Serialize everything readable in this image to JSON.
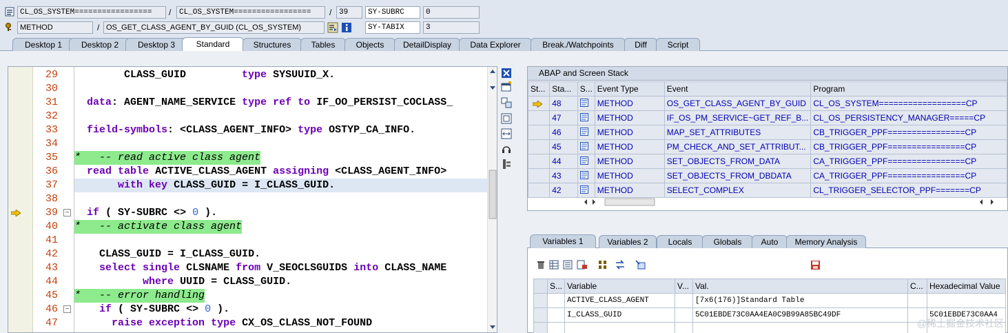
{
  "top_fields": {
    "row1": {
      "class1": "CL_OS_SYSTEM=================",
      "sep1": "/",
      "class2": "CL_OS_SYSTEM=================",
      "sep2": "/",
      "line": "39",
      "sysvar": "SY-SUBRC",
      "sysval": "0"
    },
    "row2": {
      "type": "METHOD",
      "sep": "/",
      "method": "OS_GET_CLASS_AGENT_BY_GUID (CL_OS_SYSTEM)",
      "sysvar": "SY-TABIX",
      "sysval": "3"
    }
  },
  "tabs": [
    "Desktop 1",
    "Desktop 2",
    "Desktop 3",
    "Standard",
    "Structures",
    "Tables",
    "Objects",
    "DetailDisplay",
    "Data Explorer",
    "Break./Watchpoints",
    "Diff",
    "Script"
  ],
  "active_tab": "Standard",
  "code_lines": [
    {
      "n": "29",
      "text": "        CLASS_GUID         type SYSUUID_X."
    },
    {
      "n": "30",
      "text": ""
    },
    {
      "n": "31",
      "text": "  data: AGENT_NAME_SERVICE type ref to IF_OO_PERSIST_COCLASS_"
    },
    {
      "n": "32",
      "text": ""
    },
    {
      "n": "33",
      "text": "  field-symbols: <CLASS_AGENT_INFO> type OSTYP_CA_INFO."
    },
    {
      "n": "34",
      "text": ""
    },
    {
      "n": "35",
      "text": "*   -- read active class agent"
    },
    {
      "n": "36",
      "text": "  read table ACTIVE_CLASS_AGENT assigning <CLASS_AGENT_INFO>"
    },
    {
      "n": "37",
      "text": "       with key CLASS_GUID = I_CLASS_GUID."
    },
    {
      "n": "38",
      "text": ""
    },
    {
      "n": "39",
      "text": "  if ( SY-SUBRC <> 0 )."
    },
    {
      "n": "40",
      "text": "*   -- activate class agent"
    },
    {
      "n": "41",
      "text": ""
    },
    {
      "n": "42",
      "text": "    CLASS_GUID = I_CLASS_GUID."
    },
    {
      "n": "43",
      "text": "    select single CLSNAME from V_SEOCLSGUIDS into CLASS_NAME"
    },
    {
      "n": "44",
      "text": "           where UUID = CLASS_GUID."
    },
    {
      "n": "45",
      "text": "*   -- error handling"
    },
    {
      "n": "46",
      "text": "    if ( SY-SUBRC <> 0 )."
    },
    {
      "n": "47",
      "text": "      raise exception type CX_OS_CLASS_NOT_FOUND"
    }
  ],
  "stack": {
    "title": "ABAP and Screen Stack",
    "headers": [
      "St...",
      "Sta...",
      "S...",
      "Event Type",
      "Event",
      "Program"
    ],
    "rows": [
      {
        "level": "48",
        "type": "METHOD",
        "event": "OS_GET_CLASS_AGENT_BY_GUID",
        "program": "CL_OS_SYSTEM==================CP"
      },
      {
        "level": "47",
        "type": "METHOD",
        "event": "IF_OS_PM_SERVICE~GET_REF_B...",
        "program": "CL_OS_PERSISTENCY_MANAGER=====CP"
      },
      {
        "level": "46",
        "type": "METHOD",
        "event": "MAP_SET_ATTRIBUTES",
        "program": "CB_TRIGGER_PPF================CP"
      },
      {
        "level": "45",
        "type": "METHOD",
        "event": "PM_CHECK_AND_SET_ATTRIBUT...",
        "program": "CB_TRIGGER_PPF================CP"
      },
      {
        "level": "44",
        "type": "METHOD",
        "event": "SET_OBJECTS_FROM_DATA",
        "program": "CA_TRIGGER_PPF================CP"
      },
      {
        "level": "43",
        "type": "METHOD",
        "event": "SET_OBJECTS_FROM_DBDATA",
        "program": "CA_TRIGGER_PPF================CP"
      },
      {
        "level": "42",
        "type": "METHOD",
        "event": "SELECT_COMPLEX",
        "program": "CL_TRIGGER_SELECTOR_PPF=======CP"
      }
    ]
  },
  "var_tabs": [
    "Variables 1",
    "Variables 2",
    "Locals",
    "Globals",
    "Auto",
    "Memory Analysis"
  ],
  "active_var_tab": "Variables 1",
  "variables": {
    "headers": [
      "S...",
      "Variable",
      "V...",
      "Val.",
      "C...",
      "Hexadecimal Value"
    ],
    "rows": [
      {
        "name": "ACTIVE_CLASS_AGENT",
        "value": "[7x6(176)]Standard Table",
        "hex": ""
      },
      {
        "name": "I_CLASS_GUID",
        "value": "5C01EBDE73C0AA4EA0C9B99A85BC49DF",
        "hex": "5C01EBDE73C0AA4"
      }
    ]
  },
  "watermark": "@稀土掘金技术社区",
  "colors": {
    "accent": "#2a5fe0",
    "keyword": "#6b00b5",
    "comment_bg": "#8dea8d",
    "line_number": "#c2410c"
  }
}
